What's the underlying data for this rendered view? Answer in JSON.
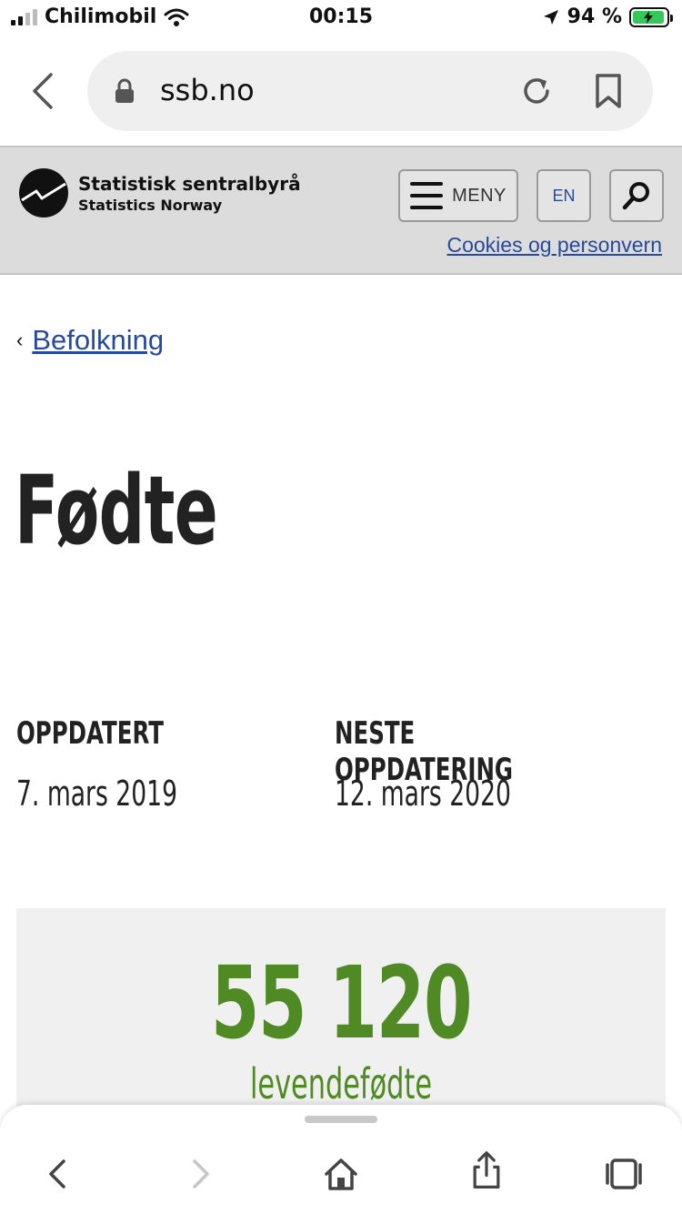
{
  "status_bar": {
    "carrier": "Chilimobil",
    "time": "00:15",
    "battery_percent": "94 %",
    "battery_level": 0.94
  },
  "browser": {
    "url": "ssb.no"
  },
  "site_header": {
    "logo_name": "Statistisk sentralbyrå",
    "logo_sub": "Statistics Norway",
    "menu_label": "MENY",
    "language_label": "EN",
    "cookies_link": "Cookies og personvern"
  },
  "breadcrumb": {
    "chevron": "‹",
    "link": "Befolkning"
  },
  "page": {
    "title": "Fødte",
    "updated_label": "OPPDATERT",
    "updated_value": "7. mars 2019",
    "next_update_label": "NESTE OPPDATERING",
    "next_update_value": "12. mars 2020"
  },
  "stat": {
    "number": "55 120",
    "label": "levendefødte"
  },
  "colors": {
    "link": "#274a9c",
    "stat_green": "#4f8a24",
    "header_bg": "#dcdcdc"
  }
}
